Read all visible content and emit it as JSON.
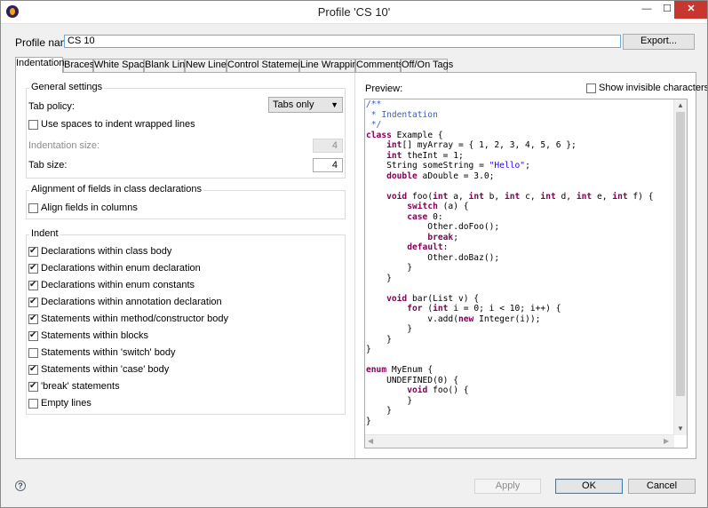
{
  "window": {
    "title": "Profile 'CS 10'",
    "minimize_glyph": "—",
    "maximize_glyph": "☐",
    "close_glyph": "✕"
  },
  "profile": {
    "label": "Profile name:",
    "value": "CS 10",
    "export_label": "Export..."
  },
  "tabs": [
    "Indentation",
    "Braces",
    "White Space",
    "Blank Lines",
    "New Lines",
    "Control Statements",
    "Line Wrapping",
    "Comments",
    "Off/On Tags"
  ],
  "active_tab": "Indentation",
  "general": {
    "title": "General settings",
    "tab_policy_label": "Tab policy:",
    "tab_policy_value": "Tabs only",
    "use_spaces_label": "Use spaces to indent wrapped lines",
    "use_spaces_checked": false,
    "indent_size_label": "Indentation size:",
    "indent_size_value": "4",
    "tab_size_label": "Tab size:",
    "tab_size_value": "4"
  },
  "alignment": {
    "title": "Alignment of fields in class declarations",
    "align_label": "Align fields in columns",
    "align_checked": false
  },
  "indent": {
    "title": "Indent",
    "items": [
      {
        "label": "Declarations within class body",
        "checked": true
      },
      {
        "label": "Declarations within enum declaration",
        "checked": true
      },
      {
        "label": "Declarations within enum constants",
        "checked": true
      },
      {
        "label": "Declarations within annotation declaration",
        "checked": true
      },
      {
        "label": "Statements within method/constructor body",
        "checked": true
      },
      {
        "label": "Statements within blocks",
        "checked": true
      },
      {
        "label": "Statements within 'switch' body",
        "checked": false
      },
      {
        "label": "Statements within 'case' body",
        "checked": true
      },
      {
        "label": "'break' statements",
        "checked": true
      },
      {
        "label": "Empty lines",
        "checked": false
      }
    ]
  },
  "preview": {
    "label": "Preview:",
    "show_invisible_label": "Show invisible characters",
    "show_invisible_checked": false,
    "code": [
      [
        [
          "c",
          "/**"
        ]
      ],
      [
        [
          "c",
          " * Indentation"
        ]
      ],
      [
        [
          "c",
          " */"
        ]
      ],
      [
        [
          "k",
          "class"
        ],
        [
          "",
          " Example {"
        ]
      ],
      [
        [
          "",
          "    "
        ],
        [
          "k",
          "int"
        ],
        [
          "",
          "[] myArray = { 1, 2, 3, 4, 5, 6 };"
        ]
      ],
      [
        [
          "",
          "    "
        ],
        [
          "k",
          "int"
        ],
        [
          "",
          " theInt = 1;"
        ]
      ],
      [
        [
          "",
          "    String someString = "
        ],
        [
          "s",
          "\"Hello\""
        ],
        [
          "",
          ";"
        ]
      ],
      [
        [
          "",
          "    "
        ],
        [
          "k",
          "double"
        ],
        [
          "",
          " aDouble = 3.0;"
        ]
      ],
      [
        [
          "",
          ""
        ]
      ],
      [
        [
          "",
          "    "
        ],
        [
          "k",
          "void"
        ],
        [
          "",
          " foo("
        ],
        [
          "k",
          "int"
        ],
        [
          "",
          " a, "
        ],
        [
          "k",
          "int"
        ],
        [
          "",
          " b, "
        ],
        [
          "k",
          "int"
        ],
        [
          "",
          " c, "
        ],
        [
          "k",
          "int"
        ],
        [
          "",
          " d, "
        ],
        [
          "k",
          "int"
        ],
        [
          "",
          " e, "
        ],
        [
          "k",
          "int"
        ],
        [
          "",
          " f) {"
        ]
      ],
      [
        [
          "",
          "        "
        ],
        [
          "k",
          "switch"
        ],
        [
          "",
          " (a) {"
        ]
      ],
      [
        [
          "",
          "        "
        ],
        [
          "k",
          "case"
        ],
        [
          "",
          " 0:"
        ]
      ],
      [
        [
          "",
          "            Other.doFoo();"
        ]
      ],
      [
        [
          "",
          "            "
        ],
        [
          "k",
          "break"
        ],
        [
          "",
          ";"
        ]
      ],
      [
        [
          "",
          "        "
        ],
        [
          "k",
          "default"
        ],
        [
          "",
          ":"
        ]
      ],
      [
        [
          "",
          "            Other.doBaz();"
        ]
      ],
      [
        [
          "",
          "        }"
        ]
      ],
      [
        [
          "",
          "    }"
        ]
      ],
      [
        [
          "",
          ""
        ]
      ],
      [
        [
          "",
          "    "
        ],
        [
          "k",
          "void"
        ],
        [
          "",
          " bar(List v) {"
        ]
      ],
      [
        [
          "",
          "        "
        ],
        [
          "k",
          "for"
        ],
        [
          "",
          " ("
        ],
        [
          "k",
          "int"
        ],
        [
          "",
          " i = 0; i < 10; i++) {"
        ]
      ],
      [
        [
          "",
          "            v.add("
        ],
        [
          "k",
          "new"
        ],
        [
          "",
          " Integer(i));"
        ]
      ],
      [
        [
          "",
          "        }"
        ]
      ],
      [
        [
          "",
          "    }"
        ]
      ],
      [
        [
          "",
          "}"
        ]
      ],
      [
        [
          "",
          ""
        ]
      ],
      [
        [
          "k",
          "enum"
        ],
        [
          "",
          " MyEnum {"
        ]
      ],
      [
        [
          "",
          "    UNDEFINED(0) {"
        ]
      ],
      [
        [
          "",
          "        "
        ],
        [
          "k",
          "void"
        ],
        [
          "",
          " foo() {"
        ]
      ],
      [
        [
          "",
          "        }"
        ]
      ],
      [
        [
          "",
          "    }"
        ]
      ],
      [
        [
          "",
          "}"
        ]
      ]
    ]
  },
  "footer": {
    "help_glyph": "?",
    "apply_label": "Apply",
    "ok_label": "OK",
    "cancel_label": "Cancel"
  },
  "colors": {
    "keyword": "#7f0055",
    "comment": "#3f5fbf",
    "string": "#2a00ff",
    "close_button": "#c7372f"
  }
}
